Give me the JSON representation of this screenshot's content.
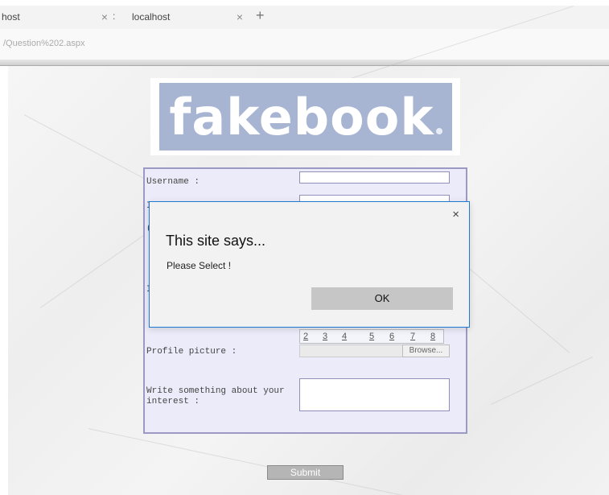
{
  "browser": {
    "tabs": [
      {
        "title": "host",
        "close": "×"
      },
      {
        "title": "localhost",
        "close": "×"
      }
    ],
    "tab_separator": ":",
    "new_tab": "+",
    "address": "/Question%202.aspx"
  },
  "page": {
    "logo_text": "fakebook",
    "form": {
      "username_label": "Username :",
      "hidden_label_2": "I",
      "hidden_label_3": "(",
      "hidden_label_4": "I",
      "numbers": [
        "2",
        "3",
        "4",
        "5",
        "6",
        "7",
        "8"
      ],
      "profile_label": "Profile picture :",
      "browse_label": "Browse...",
      "interest_label": "Write something about your interest :"
    },
    "submit_label": "Submit"
  },
  "dialog": {
    "close": "×",
    "title": "This site says...",
    "message": "Please Select !",
    "ok_label": "OK"
  },
  "colors": {
    "logo_bg": "#a7b4d2",
    "form_bg": "#ecebf9",
    "form_border": "#9a9ac4",
    "dialog_border": "#1f7bd0"
  }
}
